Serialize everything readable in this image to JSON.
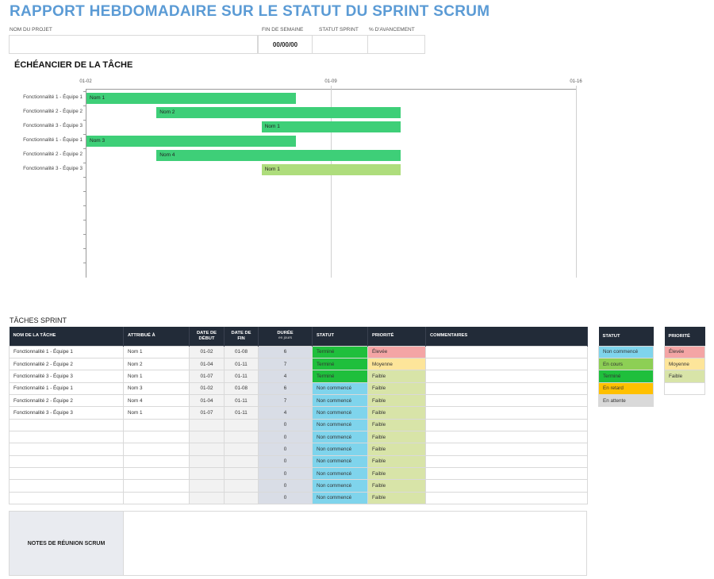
{
  "title": "RAPPORT HEBDOMADAIRE SUR LE STATUT DU SPRINT SCRUM",
  "project": {
    "name_label": "NOM DU PROJET",
    "name_value": "",
    "week_end_label": "FIN DE SEMAINE",
    "week_end_value": "00/00/00",
    "status_label": "STATUT SPRINT",
    "status_value": "",
    "progress_label": "% D'AVANCEMENT",
    "progress_value": ""
  },
  "timeline": {
    "title": "ÉCHÉANCIER DE LA TÂCHE",
    "x_ticks": [
      "01-02",
      "01-09",
      "01-16"
    ],
    "categories": [
      "Fonctionnalité 1 - Équipe 1",
      "Fonctionnalité 2 - Équipe 2",
      "Fonctionnalité 3 - Équipe 3",
      "Fonctionnalité 1 - Équipe 1",
      "Fonctionnalité 2 - Équipe 2",
      "Fonctionnalité 3 - Équipe 3"
    ],
    "bars": [
      {
        "label": "Nom 1",
        "start": "01-02",
        "end": "01-08",
        "color": "#3ecf78"
      },
      {
        "label": "Nom 2",
        "start": "01-04",
        "end": "01-11",
        "color": "#3ecf78"
      },
      {
        "label": "Nom 1",
        "start": "01-07",
        "end": "01-11",
        "color": "#3ecf78"
      },
      {
        "label": "Nom 3",
        "start": "01-02",
        "end": "01-08",
        "color": "#3ecf78"
      },
      {
        "label": "Nom 4",
        "start": "01-04",
        "end": "01-11",
        "color": "#3ecf78"
      },
      {
        "label": "Nom 1",
        "start": "01-07",
        "end": "01-11",
        "color": "#aedd7c"
      }
    ]
  },
  "sprint": {
    "label": "TÂCHES SPRINT",
    "headers": {
      "task": "NOM DE LA TÂCHE",
      "assigned": "ATTRIBUÉ À",
      "start": "DATE DE DÉBUT",
      "end": "DATE DE FIN",
      "duration": "DURÉE",
      "duration_sub": "en jours",
      "status": "STATUT",
      "priority": "PRIORITÉ",
      "comments": "COMMENTAIRES"
    },
    "rows": [
      {
        "task": "Fonctionnalité 1 - Équipe 1",
        "assigned": "Nom 1",
        "start": "01-02",
        "end": "01-08",
        "duration": "6",
        "status": "Terminé",
        "priority": "Élevée",
        "comments": ""
      },
      {
        "task": "Fonctionnalité 2 - Équipe 2",
        "assigned": "Nom 2",
        "start": "01-04",
        "end": "01-11",
        "duration": "7",
        "status": "Terminé",
        "priority": "Moyenne",
        "comments": ""
      },
      {
        "task": "Fonctionnalité 3 - Équipe 3",
        "assigned": "Nom 1",
        "start": "01-07",
        "end": "01-11",
        "duration": "4",
        "status": "Terminé",
        "priority": "Faible",
        "comments": ""
      },
      {
        "task": "Fonctionnalité 1 - Équipe 1",
        "assigned": "Nom 3",
        "start": "01-02",
        "end": "01-08",
        "duration": "6",
        "status": "Non commencé",
        "priority": "Faible",
        "comments": ""
      },
      {
        "task": "Fonctionnalité 2 - Équipe 2",
        "assigned": "Nom 4",
        "start": "01-04",
        "end": "01-11",
        "duration": "7",
        "status": "Non commencé",
        "priority": "Faible",
        "comments": ""
      },
      {
        "task": "Fonctionnalité 3 - Équipe 3",
        "assigned": "Nom 1",
        "start": "01-07",
        "end": "01-11",
        "duration": "4",
        "status": "Non commencé",
        "priority": "Faible",
        "comments": ""
      },
      {
        "task": "",
        "assigned": "",
        "start": "",
        "end": "",
        "duration": "0",
        "status": "Non commencé",
        "priority": "Faible",
        "comments": ""
      },
      {
        "task": "",
        "assigned": "",
        "start": "",
        "end": "",
        "duration": "0",
        "status": "Non commencé",
        "priority": "Faible",
        "comments": ""
      },
      {
        "task": "",
        "assigned": "",
        "start": "",
        "end": "",
        "duration": "0",
        "status": "Non commencé",
        "priority": "Faible",
        "comments": ""
      },
      {
        "task": "",
        "assigned": "",
        "start": "",
        "end": "",
        "duration": "0",
        "status": "Non commencé",
        "priority": "Faible",
        "comments": ""
      },
      {
        "task": "",
        "assigned": "",
        "start": "",
        "end": "",
        "duration": "0",
        "status": "Non commencé",
        "priority": "Faible",
        "comments": ""
      },
      {
        "task": "",
        "assigned": "",
        "start": "",
        "end": "",
        "duration": "0",
        "status": "Non commencé",
        "priority": "Faible",
        "comments": ""
      },
      {
        "task": "",
        "assigned": "",
        "start": "",
        "end": "",
        "duration": "0",
        "status": "Non commencé",
        "priority": "Faible",
        "comments": ""
      }
    ]
  },
  "status_legend": {
    "header": "STATUT",
    "items": [
      {
        "label": "Non commencé",
        "color": "#7fd4ec"
      },
      {
        "label": "En cours",
        "color": "#8dcf55"
      },
      {
        "label": "Terminé",
        "color": "#1fbf3c"
      },
      {
        "label": "En retard",
        "color": "#ffc000"
      },
      {
        "label": "En attente",
        "color": "#d9d9d9"
      }
    ]
  },
  "priority_legend": {
    "header": "PRIORITÉ",
    "items": [
      {
        "label": "Élevée",
        "color": "#f4a5a5"
      },
      {
        "label": "Moyenne",
        "color": "#fde59a"
      },
      {
        "label": "Faible",
        "color": "#d8e4a8"
      },
      {
        "label": "",
        "color": "#ffffff"
      }
    ]
  },
  "notes": {
    "label": "NOTES DE RÉUNION SCRUM",
    "value": ""
  }
}
